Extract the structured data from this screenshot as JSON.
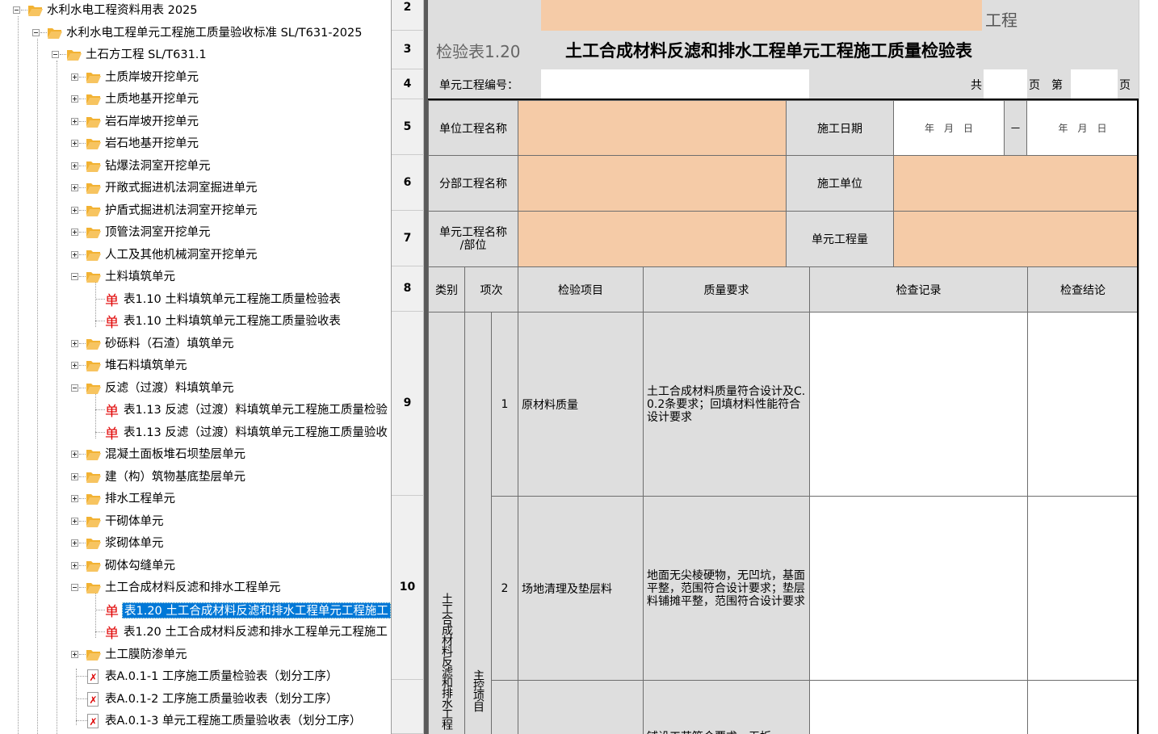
{
  "tree": {
    "nodes": [
      {
        "label": "水利水电工程资料用表 2025",
        "icon": "folder-icon",
        "expander": "minus"
      },
      {
        "label": "水利水电工程单元工程施工质量验收标准 SL/T631-2025",
        "icon": "folder-icon",
        "expander": "minus"
      },
      {
        "label": "土石方工程 SL/T631.1",
        "icon": "folder-icon",
        "expander": "minus"
      },
      {
        "label": "土质岸坡开挖单元",
        "icon": "folder-icon",
        "expander": "plus"
      },
      {
        "label": "土质地基开挖单元",
        "icon": "folder-icon",
        "expander": "plus"
      },
      {
        "label": "岩石岸坡开挖单元",
        "icon": "folder-icon",
        "expander": "plus"
      },
      {
        "label": "岩石地基开挖单元",
        "icon": "folder-icon",
        "expander": "plus"
      },
      {
        "label": "钻爆法洞室开挖单元",
        "icon": "folder-icon",
        "expander": "plus"
      },
      {
        "label": "开敞式掘进机法洞室掘进单元",
        "icon": "folder-icon",
        "expander": "plus"
      },
      {
        "label": "护盾式掘进机法洞室开挖单元",
        "icon": "folder-icon",
        "expander": "plus"
      },
      {
        "label": "顶管法洞室开挖单元",
        "icon": "folder-icon",
        "expander": "plus"
      },
      {
        "label": "人工及其他机械洞室开挖单元",
        "icon": "folder-icon",
        "expander": "plus"
      },
      {
        "label": "土料填筑单元",
        "icon": "folder-icon",
        "expander": "minus"
      },
      {
        "label": "表1.10 土料填筑单元工程施工质量检验表",
        "icon": "doc-icon",
        "glyph": "单"
      },
      {
        "label": "表1.10 土料填筑单元工程施工质量验收表",
        "icon": "doc-icon",
        "glyph": "单"
      },
      {
        "label": "砂砾料（石渣）填筑单元",
        "icon": "folder-icon",
        "expander": "plus"
      },
      {
        "label": "堆石料填筑单元",
        "icon": "folder-icon",
        "expander": "plus"
      },
      {
        "label": "反滤（过渡）料填筑单元",
        "icon": "folder-icon",
        "expander": "minus"
      },
      {
        "label": "表1.13 反滤（过渡）料填筑单元工程施工质量检验",
        "icon": "doc-icon",
        "glyph": "单"
      },
      {
        "label": "表1.13 反滤（过渡）料填筑单元工程施工质量验收",
        "icon": "doc-icon",
        "glyph": "单"
      },
      {
        "label": "混凝土面板堆石坝垫层单元",
        "icon": "folder-icon",
        "expander": "plus"
      },
      {
        "label": "建（构）筑物基底垫层单元",
        "icon": "folder-icon",
        "expander": "plus"
      },
      {
        "label": "排水工程单元",
        "icon": "folder-icon",
        "expander": "plus"
      },
      {
        "label": "干砌体单元",
        "icon": "folder-icon",
        "expander": "plus"
      },
      {
        "label": "浆砌体单元",
        "icon": "folder-icon",
        "expander": "plus"
      },
      {
        "label": "砌体勾缝单元",
        "icon": "folder-icon",
        "expander": "plus"
      },
      {
        "label": "土工合成材料反滤和排水工程单元",
        "icon": "folder-icon",
        "expander": "minus"
      },
      {
        "label": "表1.20 土工合成材料反滤和排水工程单元工程施工",
        "icon": "doc-icon",
        "glyph": "单",
        "selected": true
      },
      {
        "label": "表1.20 土工合成材料反滤和排水工程单元工程施工",
        "icon": "doc-icon",
        "glyph": "单"
      },
      {
        "label": "土工膜防渗单元",
        "icon": "folder-icon",
        "expander": "plus"
      },
      {
        "label": "表A.0.1-1 工序施工质量检验表（划分工序）",
        "icon": "pdf-icon"
      },
      {
        "label": "表A.0.1-2 工序施工质量验收表（划分工序）",
        "icon": "pdf-icon"
      },
      {
        "label": "表A.0.1-3 单元工程施工质量验收表（划分工序）",
        "icon": "pdf-icon"
      }
    ]
  },
  "row_headers": [
    "2",
    "3",
    "4",
    "5",
    "6",
    "7",
    "8",
    "9",
    "10"
  ],
  "sheet": {
    "row2_right": "工程",
    "form_no": "检验表1.20",
    "form_title": "土工合成材料反滤和排水工程单元工程施工质量检验表",
    "unit_no_label": "单元工程编号：",
    "total_label": "共",
    "page_label": "页",
    "nth_label": "第",
    "page_label2": "页",
    "unit_project_name_label": "单位工程名称",
    "construction_date_label": "施工日期",
    "date_start": "年　月　日",
    "date_sep": "－",
    "date_end": "年　月　日",
    "sub_project_name_label": "分部工程名称",
    "contractor_label": "施工单位",
    "unit_name_label": "单元工程名称",
    "unit_name_label2": "/部位",
    "unit_quantity_label": "单元工程量",
    "headers": {
      "category": "类别",
      "item_no": "项次",
      "check_item": "检验项目",
      "quality_req": "质量要求",
      "check_record": "检查记录",
      "check_conclusion": "检查结论"
    },
    "category_text": "土工合成材料反滤和排水工程",
    "main_items_text": "主控项目",
    "items": [
      {
        "no": "1",
        "name": "原材料质量",
        "requirement": "土工合成材料质量符合设计及C.0.2条要求；回填材料性能符合设计要求"
      },
      {
        "no": "2",
        "name": "场地清理及垫层料",
        "requirement": "地面无尖棱硬物，无凹坑，基面平整，范围符合设计要求；垫层料铺摊平整，范围符合设计要求"
      },
      {
        "no": "",
        "name": "",
        "requirement": "铺设工艺符合要求，无折"
      }
    ]
  }
}
